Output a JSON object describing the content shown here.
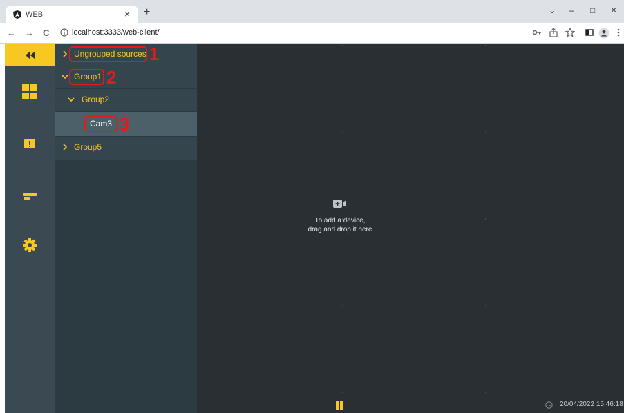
{
  "browser": {
    "tab_title": "WEB",
    "tab_close": "×",
    "new_tab": "+",
    "window_controls": {
      "dropdown": "⌄",
      "minimize": "–",
      "maximize": "□",
      "close": "×"
    },
    "nav": {
      "back": "←",
      "forward": "→",
      "reload": "C"
    },
    "url": "localhost:3333/web-client/",
    "icons": [
      "key-icon",
      "share-icon",
      "star-icon",
      "sidebar-icon",
      "profile-icon",
      "menu-icon"
    ]
  },
  "leftnav": {
    "collapse_icon": "double-chevron-left-icon",
    "items": [
      "layout-icon",
      "alert-icon",
      "camera-icon",
      "settings-icon"
    ],
    "accent_color": "#f6c821"
  },
  "tree": {
    "items": [
      {
        "label": "Ungrouped sources",
        "expanded": false,
        "level": 0,
        "annotation": "1"
      },
      {
        "label": "Group1",
        "expanded": true,
        "level": 0,
        "annotation": "2"
      },
      {
        "label": "Group2",
        "expanded": true,
        "level": 1
      },
      {
        "label": "Cam3",
        "selected": true,
        "level": 2,
        "annotation": "3"
      },
      {
        "label": "Group5",
        "expanded": false,
        "level": 0
      }
    ]
  },
  "main": {
    "empty_icon": "add-video-icon",
    "empty_line1": "To add a device,",
    "empty_line2": "drag and drop it here"
  },
  "footer": {
    "pause_icon": "pause-icon",
    "clock_icon": "clock-icon",
    "datetime": "20/04/2022 15:46:18"
  }
}
